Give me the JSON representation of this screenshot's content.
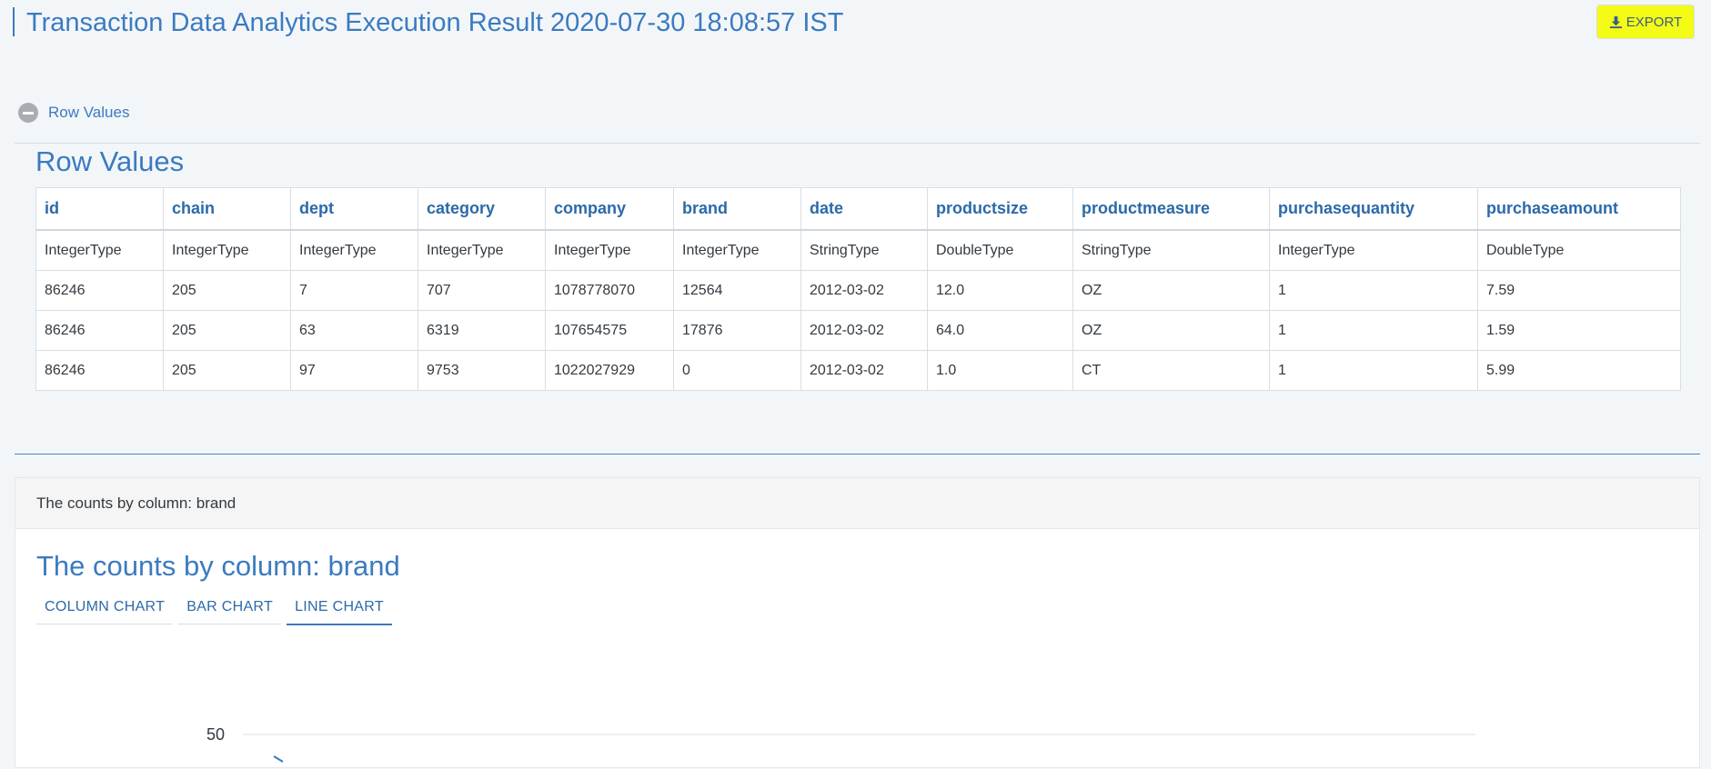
{
  "header": {
    "title": "Transaction Data Analytics Execution Result 2020-07-30 18:08:57 IST",
    "export_label": "EXPORT",
    "export_icon": "download-icon"
  },
  "toggle": {
    "label": "Row Values",
    "icon": "minus-circle-icon"
  },
  "row_values": {
    "title": "Row Values",
    "columns": [
      "id",
      "chain",
      "dept",
      "category",
      "company",
      "brand",
      "date",
      "productsize",
      "productmeasure",
      "purchasequantity",
      "purchaseamount"
    ],
    "rows": [
      [
        "IntegerType",
        "IntegerType",
        "IntegerType",
        "IntegerType",
        "IntegerType",
        "IntegerType",
        "StringType",
        "DoubleType",
        "StringType",
        "IntegerType",
        "DoubleType"
      ],
      [
        "86246",
        "205",
        "7",
        "707",
        "1078778070",
        "12564",
        "2012-03-02",
        "12.0",
        "OZ",
        "1",
        "7.59"
      ],
      [
        "86246",
        "205",
        "63",
        "6319",
        "107654575",
        "17876",
        "2012-03-02",
        "64.0",
        "OZ",
        "1",
        "1.59"
      ],
      [
        "86246",
        "205",
        "97",
        "9753",
        "1022027929",
        "0",
        "2012-03-02",
        "1.0",
        "CT",
        "1",
        "5.99"
      ]
    ]
  },
  "counts_panel": {
    "heading": "The counts by column: brand",
    "title": "The counts by column: brand",
    "tabs": [
      "COLUMN CHART",
      "BAR CHART",
      "LINE CHART"
    ],
    "active_tab": "LINE CHART"
  },
  "chart_data": {
    "type": "line",
    "title": "",
    "y_ticks_visible": [
      50
    ],
    "series": [],
    "grid": true
  },
  "colors": {
    "accent": "#3b7bc0",
    "export_highlight": "#f4fb14",
    "page_background": "#f3f6f9"
  }
}
